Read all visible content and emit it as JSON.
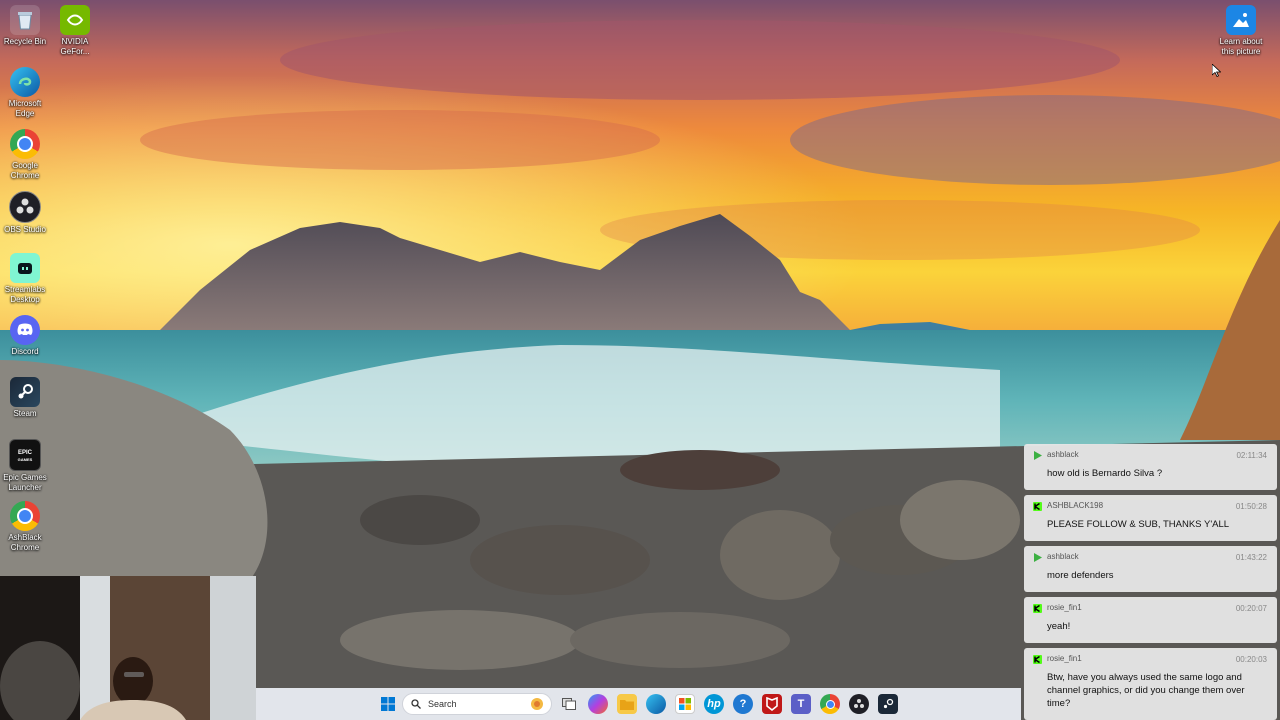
{
  "desktop": {
    "icons": [
      {
        "label": "Recycle Bin",
        "icon": "recycle-bin-icon"
      },
      {
        "label": "NVIDIA GeFor...",
        "icon": "nvidia-icon"
      },
      {
        "label": "Microsoft Edge",
        "icon": "edge-icon"
      },
      {
        "label": "Google Chrome",
        "icon": "chrome-icon"
      },
      {
        "label": "OBS Studio",
        "icon": "obs-icon"
      },
      {
        "label": "Streamlabs Desktop",
        "icon": "streamlabs-icon"
      },
      {
        "label": "Discord",
        "icon": "discord-icon"
      },
      {
        "label": "Steam",
        "icon": "steam-icon"
      },
      {
        "label": "Epic Games Launcher",
        "icon": "epic-games-icon"
      },
      {
        "label": "AshBlack Chrome",
        "icon": "chrome-profile-icon"
      }
    ],
    "spotlight": {
      "label": "Learn about this picture",
      "icon": "spotlight-icon"
    }
  },
  "chat": {
    "messages": [
      {
        "user": "ashblack",
        "time": "02:11:34",
        "text": "how old is Bernardo Silva ?",
        "platform": "play"
      },
      {
        "user": "ASHBLACK198",
        "time": "01:50:28",
        "text": "PLEASE FOLLOW & SUB, THANKS Y'ALL",
        "platform": "kick"
      },
      {
        "user": "ashblack",
        "time": "01:43:22",
        "text": "more defenders",
        "platform": "play"
      },
      {
        "user": "rosie_fin1",
        "time": "00:20:07",
        "text": "yeah!",
        "platform": "kick"
      },
      {
        "user": "rosie_fin1",
        "time": "00:20:03",
        "text": "Btw, have you always used the same logo and channel graphics, or did you change them over time?",
        "platform": "kick"
      }
    ]
  },
  "taskbar": {
    "search_label": "Search",
    "apps": [
      "start-icon",
      "search-icon",
      "widget-icon",
      "task-view-icon",
      "copilot-icon",
      "file-explorer-icon",
      "edge-icon",
      "store-icon",
      "hp-icon",
      "help-icon",
      "mcafee-icon",
      "teams-icon",
      "chrome-icon",
      "obs-icon",
      "steam-icon"
    ]
  },
  "colors": {
    "kick_green": "#53fc18",
    "chat_bg": "#e6e6e6",
    "taskbar_bg": "#ebeef4"
  }
}
